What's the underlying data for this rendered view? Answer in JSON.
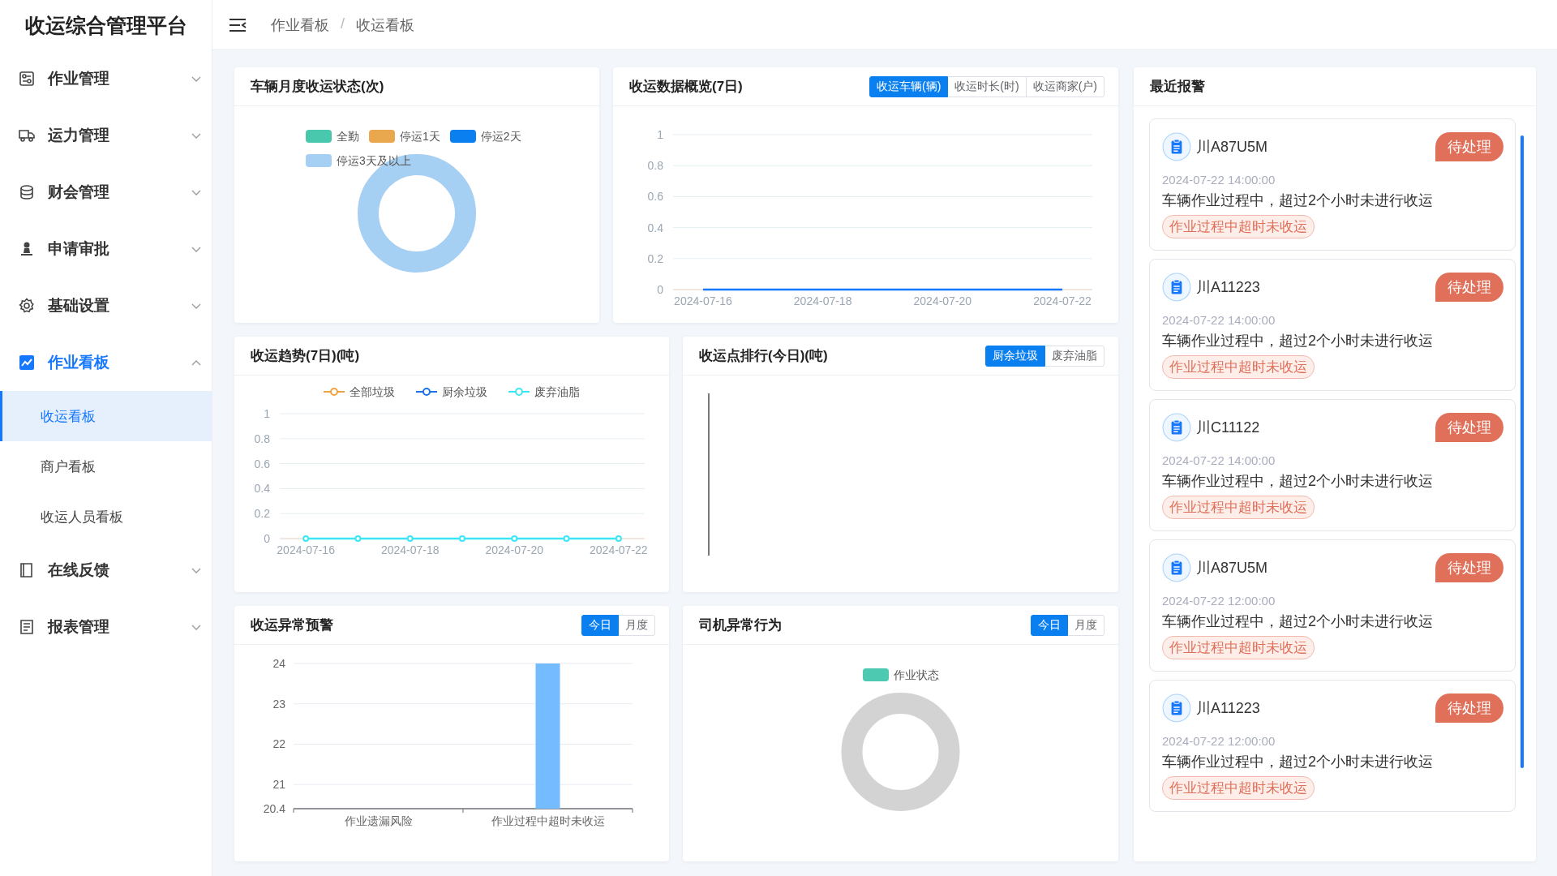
{
  "app_title": "收运综合管理平台",
  "sidebar": {
    "items": [
      {
        "label": "作业管理",
        "selected": false,
        "expanded": false
      },
      {
        "label": "运力管理",
        "selected": false,
        "expanded": false
      },
      {
        "label": "财会管理",
        "selected": false,
        "expanded": false
      },
      {
        "label": "申请审批",
        "selected": false,
        "expanded": false
      },
      {
        "label": "基础设置",
        "selected": false,
        "expanded": false
      },
      {
        "label": "作业看板",
        "selected": true,
        "expanded": true,
        "children": [
          {
            "label": "收运看板",
            "selected": true
          },
          {
            "label": "商户看板",
            "selected": false
          },
          {
            "label": "收运人员看板",
            "selected": false
          }
        ]
      },
      {
        "label": "在线反馈",
        "selected": false,
        "expanded": false
      },
      {
        "label": "报表管理",
        "selected": false,
        "expanded": false
      }
    ]
  },
  "breadcrumb": [
    "作业看板",
    "/",
    "收运看板"
  ],
  "panels": [
    {
      "kind": "donut",
      "title": "车辆月度收运状态(次)",
      "legend": [
        {
          "label": "全勤",
          "color": "#4ac8ad"
        },
        {
          "label": "停运1天",
          "color": "#eaa84e"
        },
        {
          "label": "停运2天",
          "color": "#0a7ff0"
        },
        {
          "label": "停运3天及以上",
          "color": "#a6cff4"
        }
      ]
    },
    {
      "kind": "line",
      "title": "收运数据概览(7日)",
      "tabs": [
        {
          "label": "收运车辆(辆)",
          "selected": true
        },
        {
          "label": "收运时长(时)",
          "selected": false
        },
        {
          "label": "收运商家(户)",
          "selected": false
        }
      ],
      "chart_data": {
        "type": "line",
        "categories": [
          "2024-07-16",
          null,
          "2024-07-18",
          null,
          "2024-07-20",
          null,
          "2024-07-22"
        ],
        "ylim": [
          0,
          1
        ],
        "yticks": [
          0,
          0.2,
          0.4,
          0.6,
          0.8,
          1
        ],
        "grid": true,
        "series": [
          {
            "color": "#1677ff",
            "values": [
              0,
              0,
              0,
              0,
              0,
              0,
              0
            ]
          }
        ]
      }
    },
    {
      "kind": "line",
      "title": "收运趋势(7日)(吨)",
      "chart_data": {
        "type": "line",
        "categories": [
          "2024-07-16",
          null,
          "2024-07-18",
          null,
          "2024-07-20",
          null,
          "2024-07-22"
        ],
        "ylim": [
          0,
          1
        ],
        "yticks": [
          0,
          0.2,
          0.4,
          0.6,
          0.8,
          1
        ],
        "grid": true,
        "series": [
          {
            "name": "全部垃圾",
            "color": "#f0a23c",
            "marker": "circle",
            "values": [
              null,
              null,
              null,
              null,
              null,
              null,
              null
            ]
          },
          {
            "name": "厨余垃圾",
            "color": "#1a73e8",
            "marker": "circle",
            "values": [
              null,
              null,
              null,
              null,
              null,
              null,
              null
            ]
          },
          {
            "name": "废弃油脂",
            "color": "#3de6f5",
            "marker": "circle",
            "values": [
              0,
              0,
              0,
              0,
              0,
              0,
              0
            ]
          }
        ]
      }
    },
    {
      "kind": "ranking",
      "title": "收运点排行(今日)(吨)",
      "tabs": [
        {
          "label": "厨余垃圾",
          "selected": true
        },
        {
          "label": "废弃油脂",
          "selected": false
        }
      ]
    },
    {
      "kind": "bar",
      "title": "收运异常预警",
      "tabs": [
        {
          "label": "今日",
          "selected": true
        },
        {
          "label": "月度",
          "selected": false
        }
      ],
      "chart_data": {
        "type": "bar",
        "categories": [
          "作业遗漏风险",
          "作业过程中超时未收运"
        ],
        "ylim": [
          20.4,
          24
        ],
        "yticks": [
          20.4,
          21,
          22,
          23,
          24
        ],
        "grid": true,
        "series": [
          {
            "color": "#74bcff",
            "values": [
              null,
              24
            ]
          }
        ]
      }
    },
    {
      "kind": "donut",
      "title": "司机异常行为",
      "tabs": [
        {
          "label": "今日",
          "selected": true
        },
        {
          "label": "月度",
          "selected": false
        }
      ],
      "legend": [
        {
          "label": "作业状态",
          "color": "#4cc9b0"
        }
      ]
    }
  ],
  "alerts": {
    "title": "最近报警",
    "items": [
      {
        "plate": "川A87U5M",
        "status": "待处理",
        "time": "2024-07-22 14:00:00",
        "message": "车辆作业过程中，超过2个小时未进行收运",
        "tag": "作业过程中超时未收运"
      },
      {
        "plate": "川A11223",
        "status": "待处理",
        "time": "2024-07-22 14:00:00",
        "message": "车辆作业过程中，超过2个小时未进行收运",
        "tag": "作业过程中超时未收运"
      },
      {
        "plate": "川C11122",
        "status": "待处理",
        "time": "2024-07-22 14:00:00",
        "message": "车辆作业过程中，超过2个小时未进行收运",
        "tag": "作业过程中超时未收运"
      },
      {
        "plate": "川A87U5M",
        "status": "待处理",
        "time": "2024-07-22 12:00:00",
        "message": "车辆作业过程中，超过2个小时未进行收运",
        "tag": "作业过程中超时未收运"
      },
      {
        "plate": "川A11223",
        "status": "待处理",
        "time": "2024-07-22 12:00:00",
        "message": "车辆作业过程中，超过2个小时未进行收运",
        "tag": "作业过程中超时未收运"
      }
    ]
  }
}
